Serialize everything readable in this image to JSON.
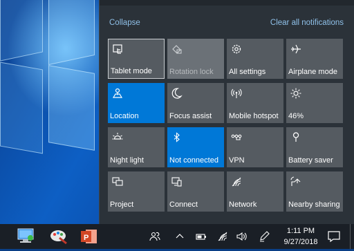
{
  "action_center": {
    "collapse_label": "Collapse",
    "clear_label": "Clear all notifications",
    "tiles": [
      {
        "label": "Tablet mode",
        "icon": "tablet-mode-icon",
        "state": "focused"
      },
      {
        "label": "Rotation lock",
        "icon": "rotation-lock-icon",
        "state": "disabled"
      },
      {
        "label": "All settings",
        "icon": "gear-icon",
        "state": "normal"
      },
      {
        "label": "Airplane mode",
        "icon": "airplane-icon",
        "state": "normal"
      },
      {
        "label": "Location",
        "icon": "location-icon",
        "state": "active"
      },
      {
        "label": "Focus assist",
        "icon": "moon-icon",
        "state": "normal"
      },
      {
        "label": "Mobile hotspot",
        "icon": "hotspot-icon",
        "state": "normal"
      },
      {
        "label": "46%",
        "icon": "brightness-icon",
        "state": "normal"
      },
      {
        "label": "Night light",
        "icon": "night-light-icon",
        "state": "normal"
      },
      {
        "label": "Not connected",
        "icon": "bluetooth-icon",
        "state": "active"
      },
      {
        "label": "VPN",
        "icon": "vpn-icon",
        "state": "normal"
      },
      {
        "label": "Battery saver",
        "icon": "battery-saver-icon",
        "state": "normal"
      },
      {
        "label": "Project",
        "icon": "project-icon",
        "state": "normal"
      },
      {
        "label": "Connect",
        "icon": "connect-icon",
        "state": "normal"
      },
      {
        "label": "Network",
        "icon": "network-icon",
        "state": "normal"
      },
      {
        "label": "Nearby sharing",
        "icon": "nearby-sharing-icon",
        "state": "normal"
      }
    ]
  },
  "taskbar": {
    "apps": [
      "remote-desktop-app-icon",
      "paint-app-icon",
      "powerpoint-app-icon"
    ],
    "tray": [
      "people-icon",
      "chevron-up-icon",
      "battery-icon",
      "wifi-icon",
      "volume-icon",
      "pen-icon"
    ],
    "time": "1:11 PM",
    "date": "9/27/2018"
  },
  "colors": {
    "accent": "#0078d7",
    "tile": "#555b61",
    "panel": "#2b3239",
    "link": "#8fc0e8"
  }
}
